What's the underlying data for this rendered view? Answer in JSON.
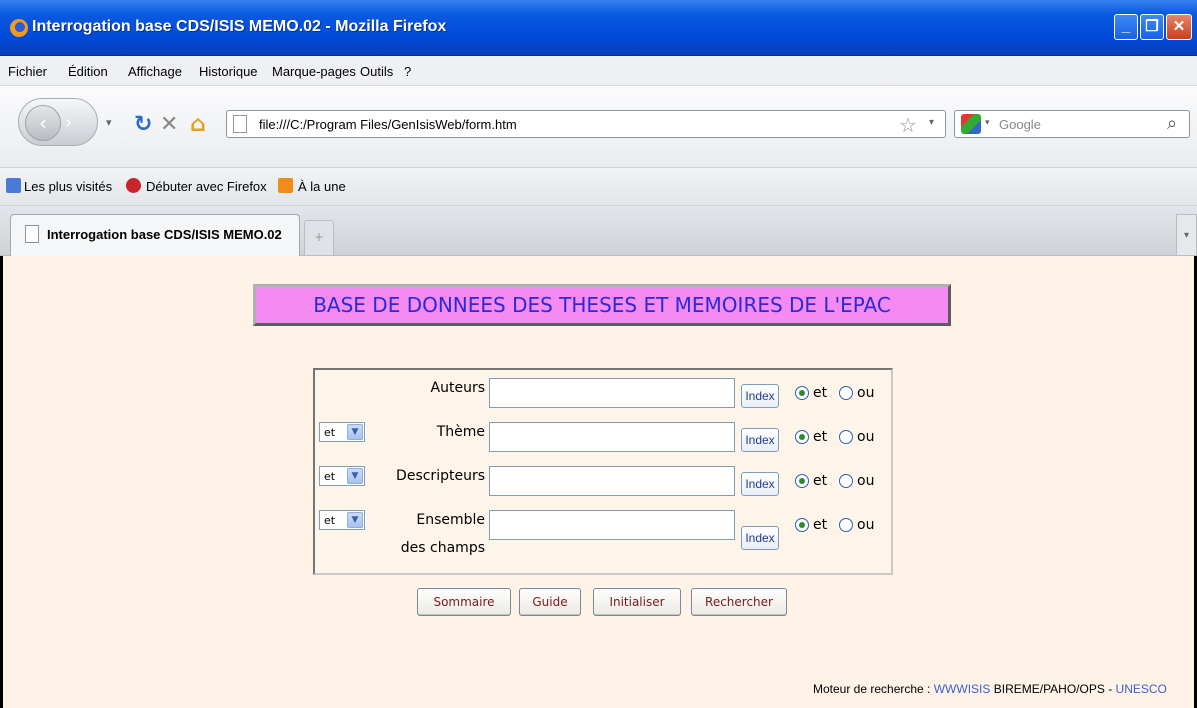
{
  "window": {
    "title": "Interrogation base CDS/ISIS MEMO.02 - Mozilla Firefox"
  },
  "menu": [
    "Fichier",
    "Édition",
    "Affichage",
    "Historique",
    "Marque-pages",
    "Outils",
    "?"
  ],
  "nav": {
    "url": "file:///C:/Program Files/GenIsisWeb/form.htm",
    "search_placeholder": "Google"
  },
  "bookmarks": [
    "Les plus visités",
    "Débuter avec Firefox",
    "À la une"
  ],
  "tab": {
    "title": "Interrogation base CDS/ISIS MEMO.02",
    "new_tab": "+"
  },
  "page": {
    "banner": "BASE DE DONNEES DES THESES ET MEMOIRES DE L'EPAC",
    "fields": [
      {
        "label": "Auteurs",
        "operator": "",
        "index_label": "Index",
        "radio_et": "et",
        "radio_ou": "ou",
        "value": ""
      },
      {
        "label": "Thème",
        "operator": "et",
        "index_label": "Index",
        "radio_et": "et",
        "radio_ou": "ou",
        "value": ""
      },
      {
        "label": "Descripteurs",
        "operator": "et",
        "index_label": "Index",
        "radio_et": "et",
        "radio_ou": "ou",
        "value": ""
      },
      {
        "label_line1": "Ensemble",
        "label_line2": "des champs",
        "operator": "et",
        "index_label": "Index",
        "radio_et": "et",
        "radio_ou": "ou",
        "value": ""
      }
    ],
    "buttons": {
      "summary": "Sommaire",
      "guide": "Guide",
      "reset": "Initialiser",
      "search": "Rechercher"
    },
    "footer": {
      "prefix": "Moteur de recherche : ",
      "engine": "WWWISIS",
      "org": " BIREME/PAHO/OPS - ",
      "partner": "UNESCO"
    }
  }
}
